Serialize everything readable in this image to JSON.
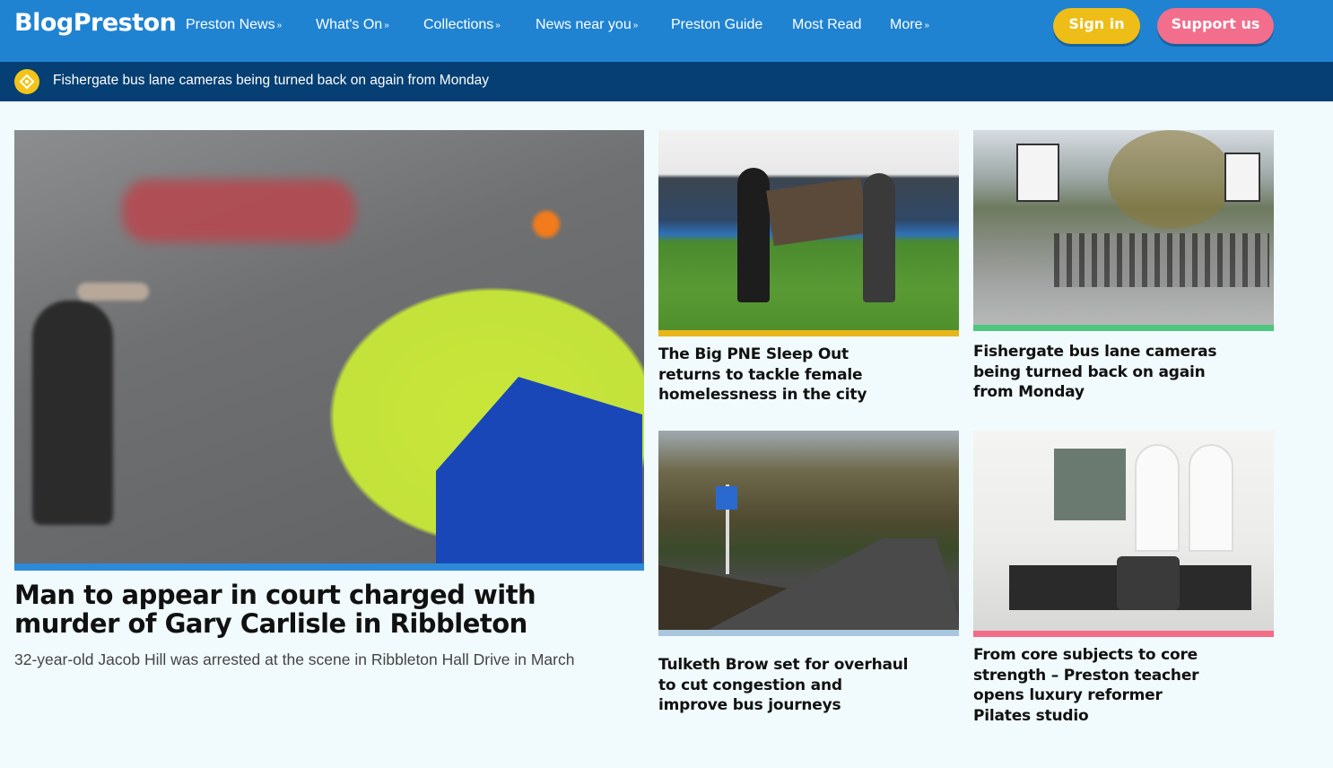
{
  "header": {
    "logo": "BlogPreston",
    "nav": [
      {
        "label": "Preston News",
        "dropdown": true
      },
      {
        "label": "What's On",
        "dropdown": true
      },
      {
        "label": "Collections",
        "dropdown": true
      },
      {
        "label": "News near you",
        "dropdown": true
      },
      {
        "label": "Preston Guide",
        "dropdown": false
      },
      {
        "label": "Most Read",
        "dropdown": false
      },
      {
        "label": "More",
        "dropdown": true
      }
    ],
    "signin_label": "Sign in",
    "support_label": "Support us",
    "chevron": "»"
  },
  "breaking": {
    "text": "Fishergate bus lane cameras being turned back on again from Monday",
    "icon": "diamond-sign-icon"
  },
  "main_article": {
    "title": "Man to appear in court charged with murder of Gary Carlisle in Ribbleton",
    "standfirst": "32-year-old Jacob Hill was arrested at the scene in Ribbleton Hall Drive in March",
    "accent": "#2c8ad8"
  },
  "cards": [
    {
      "title": "The Big PNE Sleep Out returns to tackle female homelessness in the city",
      "accent": "#e8b51a"
    },
    {
      "title": "Fishergate bus lane cameras being turned back on again from Monday",
      "accent": "#4dc77f"
    },
    {
      "title": "Tulketh Brow set for overhaul to cut congestion and improve bus journeys",
      "accent": "#a9c6dd"
    },
    {
      "title": "From core subjects to core strength – Preston teacher opens luxury reformer Pilates studio",
      "accent": "#f26c88"
    }
  ],
  "colors": {
    "nav_bg": "#1f83d2",
    "breaking_bg": "#053f73",
    "signin_bg": "#eebd17",
    "support_bg": "#f36e8c",
    "page_bg": "#f1fbfd"
  }
}
